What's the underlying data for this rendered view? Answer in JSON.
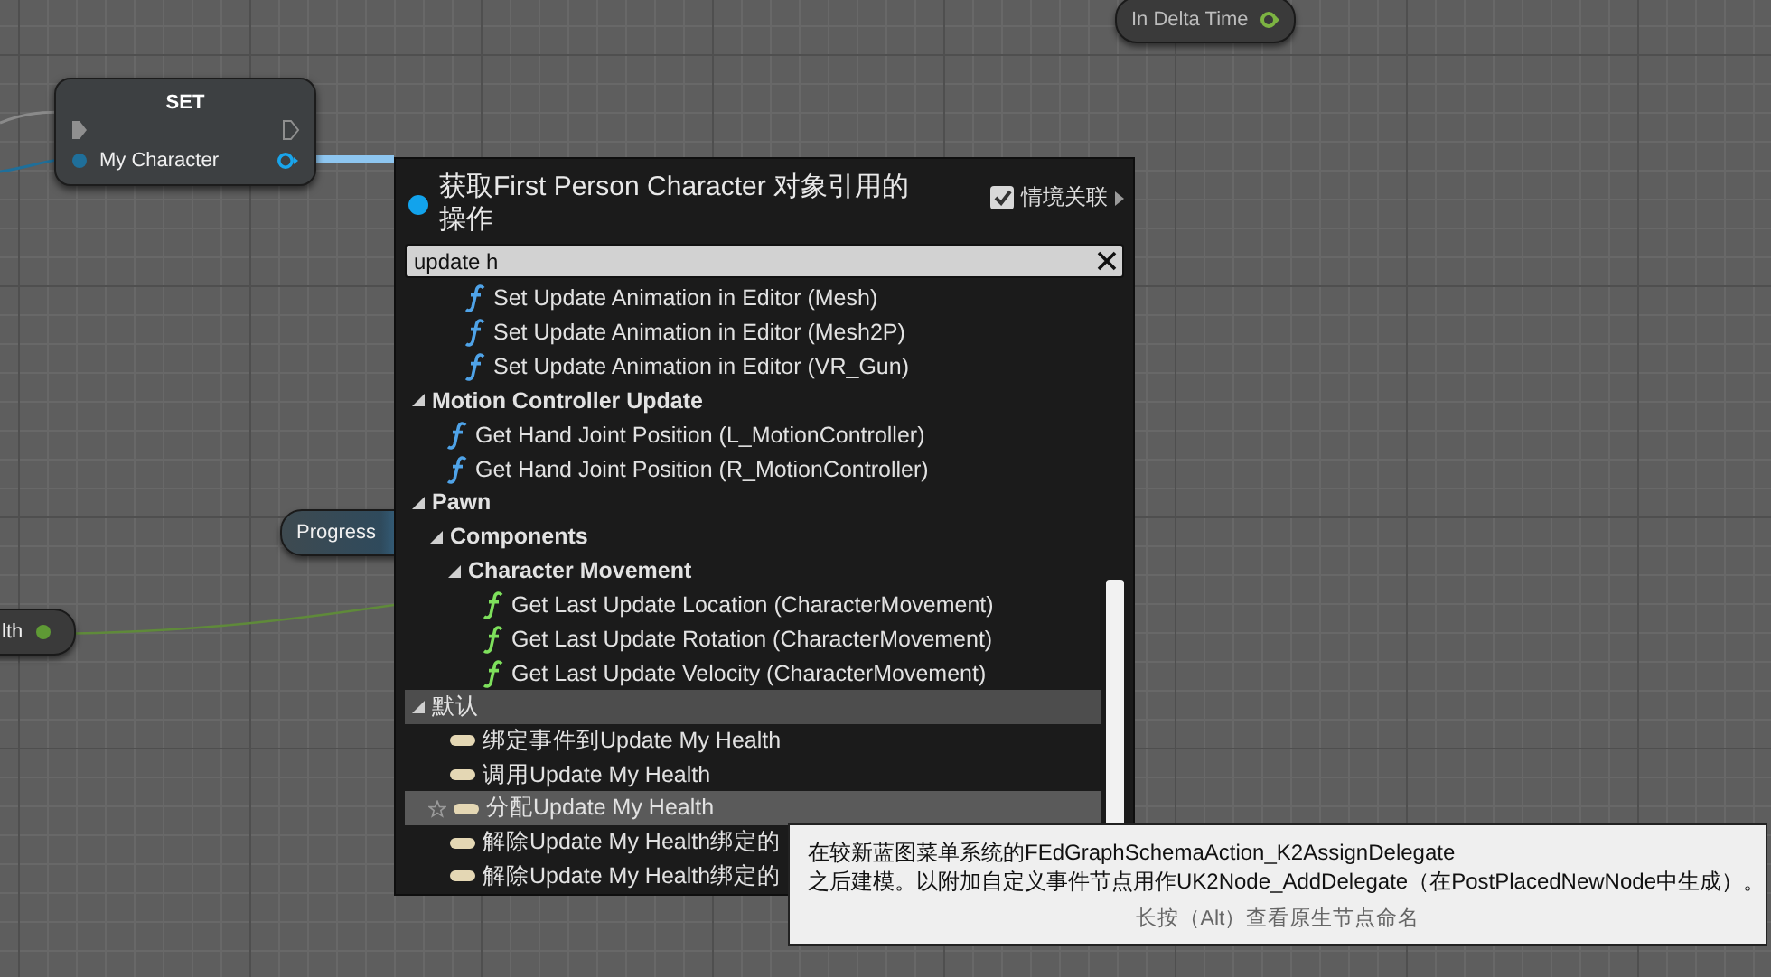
{
  "graph": {
    "delta_node": {
      "label": "In Delta Time"
    },
    "set_node": {
      "title": "SET",
      "pin_label": "My Character"
    },
    "progress_node": {
      "label": "Progress"
    },
    "health_node": {
      "label": "lth"
    }
  },
  "menu": {
    "title_lines": [
      "获取First Person Character 对象引用的",
      "操作"
    ],
    "context_toggle": {
      "label": "情境关联",
      "checked": true
    },
    "search": {
      "value": "update h"
    },
    "tree": [
      {
        "kind": "group",
        "children": [
          {
            "kind": "group",
            "children": [
              {
                "kind": "function",
                "label": "Set Update Animation in Editor (Mesh)",
                "color": "#4fa3e8"
              },
              {
                "kind": "function",
                "label": "Set Update Animation in Editor (Mesh2P)",
                "color": "#4fa3e8"
              },
              {
                "kind": "function",
                "label": "Set Update Animation in Editor (VR_Gun)",
                "color": "#4fa3e8"
              }
            ]
          }
        ]
      },
      {
        "kind": "category",
        "label": "Motion Controller Update",
        "expanded": true,
        "highlighted": false,
        "children": [
          {
            "kind": "function",
            "label": "Get Hand Joint Position (L_MotionController)",
            "color": "#4fa3e8"
          },
          {
            "kind": "function",
            "label": "Get Hand Joint Position (R_MotionController)",
            "color": "#4fa3e8"
          }
        ]
      },
      {
        "kind": "category",
        "label": "Pawn",
        "expanded": true,
        "highlighted": false,
        "children": [
          {
            "kind": "category",
            "label": "Components",
            "expanded": true,
            "highlighted": false,
            "children": [
              {
                "kind": "category",
                "label": "Character Movement",
                "expanded": true,
                "highlighted": false,
                "children": [
                  {
                    "kind": "function",
                    "label": "Get Last Update Location (CharacterMovement)",
                    "color": "#7ee05c"
                  },
                  {
                    "kind": "function",
                    "label": "Get Last Update Rotation (CharacterMovement)",
                    "color": "#7ee05c"
                  },
                  {
                    "kind": "function",
                    "label": "Get Last Update Velocity (CharacterMovement)",
                    "color": "#7ee05c"
                  }
                ]
              }
            ]
          }
        ]
      },
      {
        "kind": "category",
        "label": "默认",
        "expanded": true,
        "highlighted": true,
        "children": [
          {
            "kind": "delegate",
            "label": "绑定事件到Update My Health",
            "selected": false
          },
          {
            "kind": "delegate",
            "label": "调用Update My Health",
            "selected": false
          },
          {
            "kind": "delegate",
            "label": "分配Update My Health",
            "selected": true
          },
          {
            "kind": "delegate",
            "label": "解除Update My Health绑定的",
            "selected": false
          },
          {
            "kind": "delegate",
            "label": "解除Update My Health绑定的",
            "selected": false
          }
        ]
      }
    ]
  },
  "tooltip": {
    "lines": [
      "在较新蓝图菜单系统的FEdGraphSchemaAction_K2AssignDelegate",
      "之后建模。以附加自定义事件节点用作UK2Node_AddDelegate（在PostPlacedNewNode中生成）。"
    ],
    "hint": "长按（Alt）查看原生节点命名"
  }
}
